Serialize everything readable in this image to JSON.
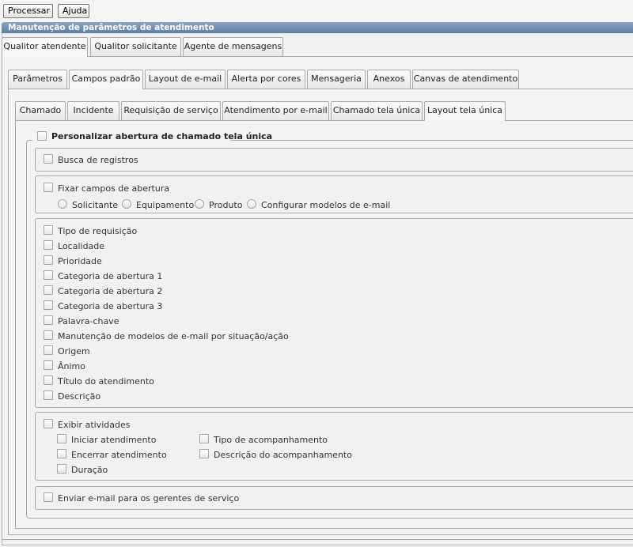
{
  "toolbar": {
    "process": "Processar",
    "help": "Ajuda"
  },
  "panel": {
    "title": "Manutenção de parâmetros de atendimento"
  },
  "tabs_l1": [
    "Qualitor atendente",
    "Qualitor solicitante",
    "Agente de mensagens"
  ],
  "tabs_l2": [
    "Parâmetros",
    "Campos padrão",
    "Layout de e-mail",
    "Alerta por cores",
    "Mensageria",
    "Anexos",
    "Canvas de atendimento"
  ],
  "tabs_l3": [
    "Chamado",
    "Incidente",
    "Requisição de serviço",
    "Atendimento por e-mail",
    "Chamado tela única",
    "Layout tela única"
  ],
  "form": {
    "main_toggle": "Personalizar abertura de chamado tela única",
    "search": "Busca de registros",
    "fix_fields": "Fixar campos de abertura",
    "radios": [
      "Solicitante",
      "Equipamento",
      "Produto",
      "Configurar modelos de e-mail"
    ],
    "fields": [
      "Tipo de requisição",
      "Localidade",
      "Prioridade",
      "Categoria de abertura 1",
      "Categoria de abertura 2",
      "Categoria de abertura 3",
      "Palavra-chave",
      "Manutenção de modelos de e-mail por situação/ação",
      "Origem",
      "Ânimo",
      "Título do atendimento",
      "Descrição"
    ],
    "activities": "Exibir atividades",
    "activities_left": [
      "Iniciar atendimento",
      "Encerrar atendimento",
      "Duração"
    ],
    "activities_right": [
      "Tipo de acompanhamento",
      "Descrição do acompanhamento"
    ],
    "email_managers": "Enviar e-mail para os gerentes de serviço"
  }
}
